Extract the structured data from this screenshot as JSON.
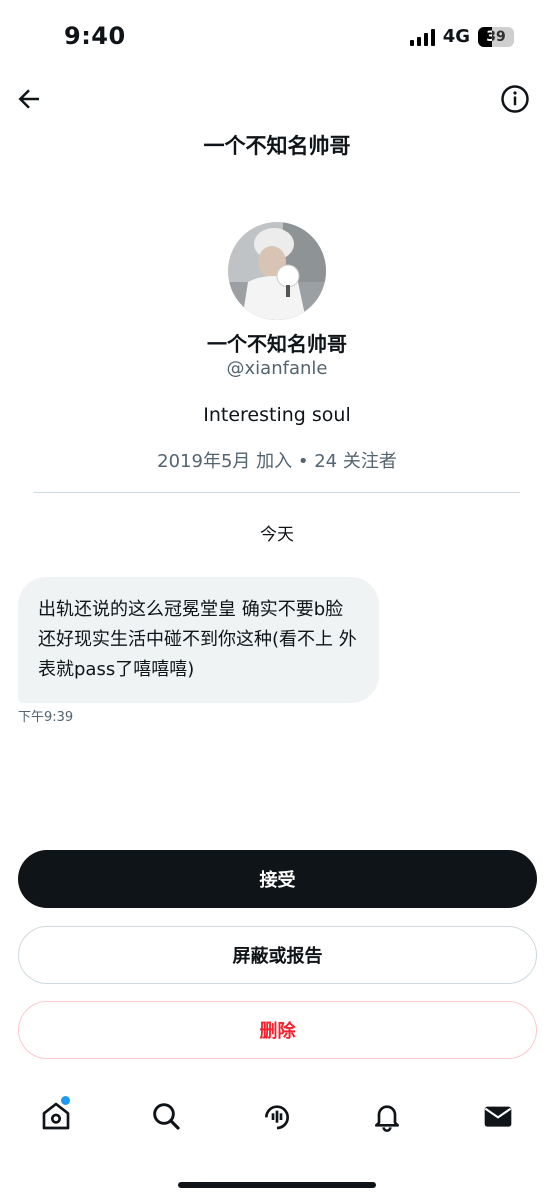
{
  "status_bar": {
    "time": "9:40",
    "network": "4G",
    "battery": "39",
    "battery_level": 0.39
  },
  "header": {
    "title": "一个不知名帅哥"
  },
  "profile": {
    "name": "一个不知名帅哥",
    "handle": "@xianfanle",
    "bio": "Interesting soul",
    "meta": "2019年5月 加入 • 24 关注者"
  },
  "conversation": {
    "day_label": "今天",
    "messages": [
      {
        "text": "出轨还说的这么冠冕堂皇 确实不要b脸 还好现实生活中碰不到你这种(看不上 外表就pass了嘻嘻嘻)",
        "time": "下午9:39"
      }
    ]
  },
  "actions": {
    "accept": "接受",
    "block_report": "屏蔽或报告",
    "delete": "删除"
  },
  "tab_bar": {
    "items": [
      {
        "icon": "home-icon",
        "badge": true
      },
      {
        "icon": "search-icon"
      },
      {
        "icon": "spaces-icon"
      },
      {
        "icon": "bell-icon"
      },
      {
        "icon": "mail-icon"
      }
    ]
  },
  "colors": {
    "accent": "#1d9bf0",
    "danger": "#f4212e",
    "primary_button": "#0f1419",
    "bubble": "#eff3f4"
  }
}
